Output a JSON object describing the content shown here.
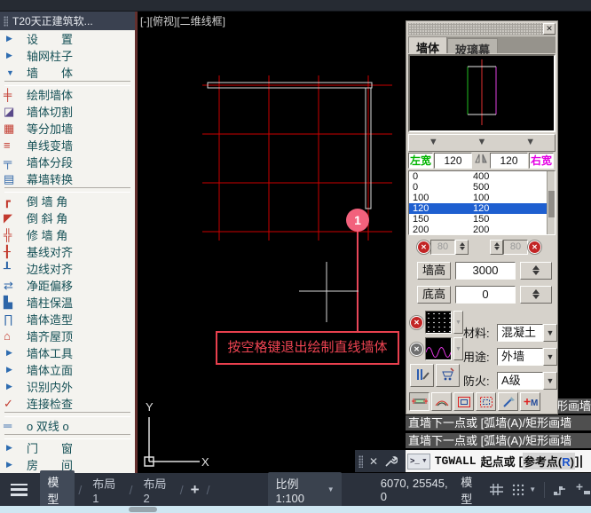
{
  "window": {
    "viewport_label": "[-][俯视][二维线框]"
  },
  "sidebar": {
    "title": "T20天正建筑软...",
    "items": [
      {
        "name": "menu-settings",
        "type": "group",
        "arrow": "right",
        "label": "设　　置"
      },
      {
        "name": "menu-axis-grid",
        "type": "group",
        "arrow": "right",
        "label": "轴网柱子"
      },
      {
        "name": "menu-wall",
        "type": "group",
        "arrow": "down",
        "label": "墙　　体"
      },
      {
        "type": "sep"
      },
      {
        "name": "tool-draw-wall",
        "type": "tool",
        "icon": {
          "name": "draw-wall-icon",
          "glyph": "╪",
          "color": "#c23a2e"
        },
        "label": "绘制墙体"
      },
      {
        "name": "tool-wall-cut",
        "type": "tool",
        "icon": {
          "name": "wall-cut-icon",
          "glyph": "◪",
          "color": "#5a4a8a"
        },
        "label": "墙体切割"
      },
      {
        "name": "tool-equal-add-wall",
        "type": "tool",
        "icon": {
          "name": "equal-divide-icon",
          "glyph": "▦",
          "color": "#c23a2e"
        },
        "label": "等分加墙"
      },
      {
        "name": "tool-line-to-wall",
        "type": "tool",
        "icon": {
          "name": "line-to-wall-icon",
          "glyph": "≡",
          "color": "#c23a2e"
        },
        "label": "单线变墙"
      },
      {
        "name": "tool-wall-segment",
        "type": "tool",
        "icon": {
          "name": "wall-segment-icon",
          "glyph": "╤",
          "color": "#2e66a8"
        },
        "label": "墙体分段"
      },
      {
        "name": "tool-curtain-convert",
        "type": "tool",
        "icon": {
          "name": "curtain-convert-icon",
          "glyph": "▤",
          "color": "#2e66a8"
        },
        "label": "幕墙转换"
      },
      {
        "type": "sep"
      },
      {
        "name": "tool-fillet-wall",
        "type": "tool",
        "icon": {
          "name": "fillet-wall-icon",
          "glyph": "┏",
          "color": "#c23a2e"
        },
        "label": "倒 墙 角"
      },
      {
        "name": "tool-chamfer-wall",
        "type": "tool",
        "icon": {
          "name": "chamfer-wall-icon",
          "glyph": "◤",
          "color": "#c23a2e"
        },
        "label": "倒 斜 角"
      },
      {
        "name": "tool-fix-corner",
        "type": "tool",
        "icon": {
          "name": "fix-corner-icon",
          "glyph": "╬",
          "color": "#c23a2e"
        },
        "label": "修 墙 角"
      },
      {
        "name": "tool-baseline-align",
        "type": "tool",
        "icon": {
          "name": "baseline-align-icon",
          "glyph": "╂",
          "color": "#c23a2e"
        },
        "label": "基线对齐"
      },
      {
        "name": "tool-edge-align",
        "type": "tool",
        "icon": {
          "name": "edge-align-icon",
          "glyph": "┸",
          "color": "#2e66a8"
        },
        "label": "边线对齐"
      },
      {
        "name": "tool-clear-offset",
        "type": "tool",
        "icon": {
          "name": "clear-offset-icon",
          "glyph": "⇄",
          "color": "#2e66a8"
        },
        "label": "净距偏移"
      },
      {
        "name": "tool-wall-insulation",
        "type": "tool",
        "icon": {
          "name": "wall-insulation-icon",
          "glyph": "▙",
          "color": "#2e66a8"
        },
        "label": "墙柱保温"
      },
      {
        "name": "tool-wall-shape",
        "type": "tool",
        "icon": {
          "name": "wall-shape-icon",
          "glyph": "∏",
          "color": "#2e66a8"
        },
        "label": "墙体造型"
      },
      {
        "name": "tool-wall-to-roof",
        "type": "tool",
        "icon": {
          "name": "wall-to-roof-icon",
          "glyph": "⌂",
          "color": "#c23a2e"
        },
        "label": "墙齐屋顶"
      },
      {
        "name": "menu-wall-tools",
        "type": "group",
        "arrow": "right",
        "label": "墙体工具"
      },
      {
        "name": "menu-wall-elevation",
        "type": "group",
        "arrow": "right",
        "label": "墙体立面"
      },
      {
        "name": "menu-identify-inout",
        "type": "group",
        "arrow": "right",
        "label": "识别内外"
      },
      {
        "name": "tool-connection-check",
        "type": "tool",
        "icon": {
          "name": "connection-check-icon",
          "glyph": "✓",
          "color": "#c23a2e"
        },
        "label": "连接检查"
      },
      {
        "type": "sep"
      },
      {
        "name": "tool-double-line",
        "type": "tool",
        "icon": {
          "name": "double-line-icon",
          "glyph": "═",
          "color": "#2e66a8"
        },
        "label": "o 双线 o"
      },
      {
        "type": "sep"
      },
      {
        "name": "menu-door-window",
        "type": "group",
        "arrow": "right",
        "label": "门　　窗"
      },
      {
        "name": "menu-room",
        "type": "group",
        "arrow": "right",
        "label": "房　　间"
      }
    ]
  },
  "drawing": {
    "marker_label": "1",
    "tooltip": "按空格键退出绘制直线墙体",
    "ucs": {
      "x_label": "X",
      "y_label": "Y"
    }
  },
  "panel": {
    "tabs": [
      {
        "label": "墙体"
      },
      {
        "label": "玻璃幕"
      }
    ],
    "width_editor": {
      "left_header": "左宽",
      "right_header": "右宽",
      "left_width": "120",
      "right_width": "120",
      "rows": [
        [
          "0",
          "400"
        ],
        [
          "0",
          "500"
        ],
        [
          "100",
          "100"
        ],
        [
          "120",
          "120"
        ],
        [
          "150",
          "150"
        ],
        [
          "200",
          "200"
        ]
      ],
      "selected_index": 3,
      "left_spin": "80",
      "right_spin": "80"
    },
    "wall_height_label": "墙高",
    "wall_height": "3000",
    "base_height_label": "底高",
    "base_height": "0",
    "material_label": "材料:",
    "material": "混凝土",
    "usage_label": "用途:",
    "usage": "外墙",
    "fire_label": "防火:",
    "fire": "A级"
  },
  "command": {
    "covered_fragment": "形画墙",
    "history": [
      "直墙下一点或 [弧墙(A)/矩形画墙",
      "直墙下一点或 [弧墙(A)/矩形画墙"
    ],
    "prompt_cmd": "TGWALL",
    "prompt_text": "起点或",
    "opt_open": "[",
    "opt_label": "参考点(",
    "opt_key": "R",
    "opt_close": ")",
    "opt_end": "]"
  },
  "statusbar": {
    "layout_tabs": [
      "模型",
      "布局1",
      "布局2"
    ],
    "new_layout": "+",
    "scale": "比例 1:100",
    "coords": "6070, 25545, 0",
    "space": "模型"
  },
  "colors": {
    "grid_red": "#cc0000",
    "wall_white": "#dcdcdc",
    "marker_pink": "#f2617c",
    "tooltip_red": "#ee4356",
    "selection_blue": "#1e5fd0",
    "left_width_green": "#00b400",
    "right_width_magenta": "#e400e4"
  }
}
